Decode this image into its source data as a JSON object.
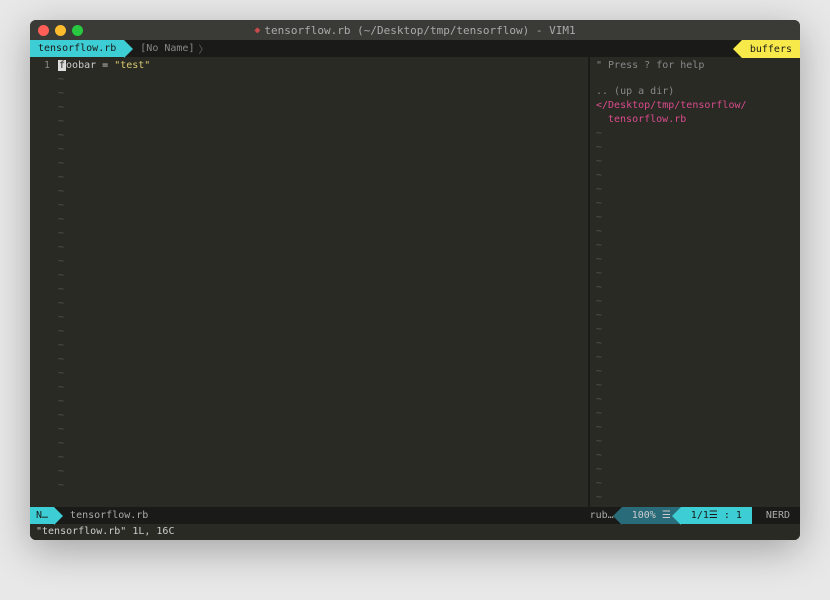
{
  "titlebar": {
    "title": "tensorflow.rb (~/Desktop/tmp/tensorflow) - VIM1"
  },
  "tabs": {
    "active": "tensorflow.rb",
    "inactive": "[No Name]",
    "buffers_label": "buffers"
  },
  "editor": {
    "line_number": "1",
    "code_prefix": "f",
    "code_rest": "oobar = ",
    "code_string": "\"test\""
  },
  "tree": {
    "help": "\" Press ? for help",
    "up": ".. (up a dir)",
    "path": "</Desktop/tmp/tensorflow/",
    "file": "tensorflow.rb"
  },
  "status": {
    "mode": "N…",
    "filename": "tensorflow.rb",
    "filetype": "rub…",
    "percent": "100% ☰",
    "position": "1/1☰ :  1",
    "nerd": "NERD"
  },
  "cmdline": {
    "text": "\"tensorflow.rb\" 1L, 16C"
  }
}
